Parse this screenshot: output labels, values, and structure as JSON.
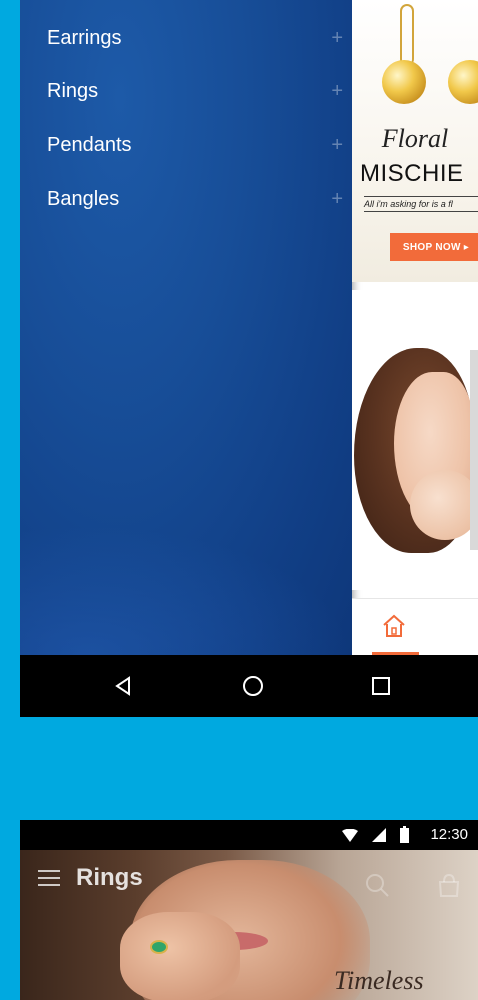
{
  "drawer": {
    "items": [
      {
        "label": "Earrings",
        "expand_icon": "plus-icon"
      },
      {
        "label": "Rings",
        "expand_icon": "plus-icon"
      },
      {
        "label": "Pendants",
        "expand_icon": "plus-icon"
      },
      {
        "label": "Bangles",
        "expand_icon": "plus-icon"
      }
    ]
  },
  "banner": {
    "script_title": "Floral",
    "title": "MISCHIE",
    "tagline": "All i'm asking for is a fl",
    "cta_label": "SHOP NOW ▸"
  },
  "bottom_nav": {
    "home_icon": "home-icon"
  },
  "system_nav": {
    "back_icon": "back-triangle-icon",
    "home_icon": "circle-home-icon",
    "recents_icon": "square-recents-icon"
  },
  "status_bar": {
    "time": "12:30"
  },
  "rings_screen": {
    "title": "Rings",
    "hero_text": "Timeless"
  },
  "colors": {
    "page_bg": "#00a9e0",
    "drawer_bg": "#174d97",
    "accent": "#f26b3a"
  }
}
